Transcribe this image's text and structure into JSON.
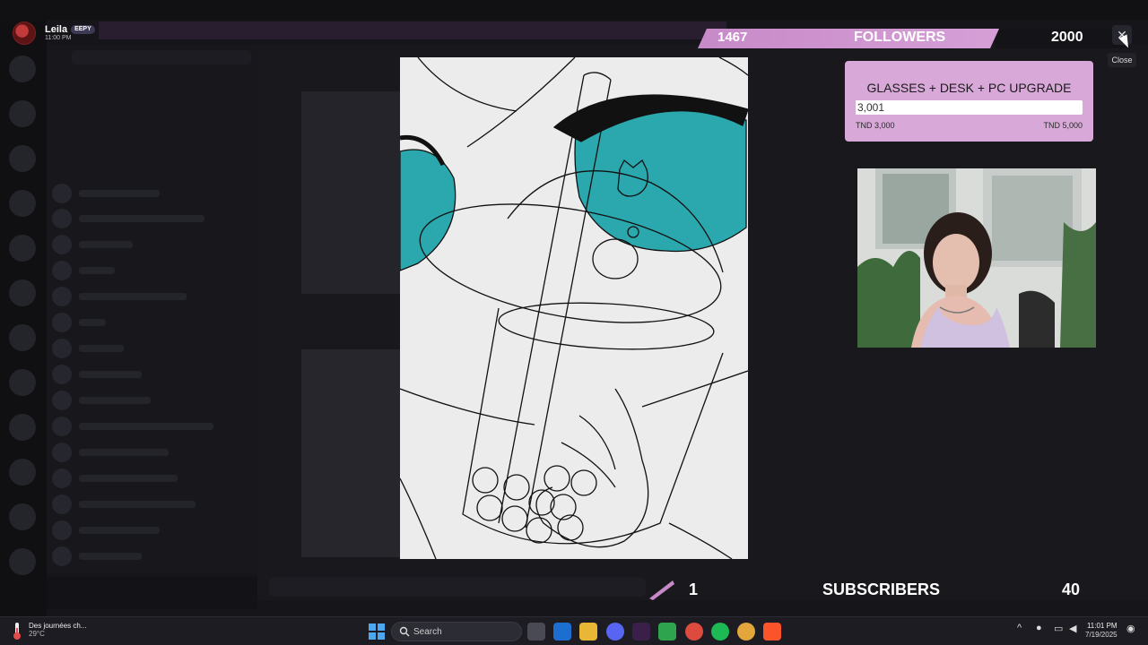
{
  "user": {
    "name": "Leila",
    "badge": "EEPY",
    "time": "11:00 PM"
  },
  "followers": {
    "count": "1467",
    "label": "FOLLOWERS",
    "goal": "2000"
  },
  "close": {
    "icon": "close-icon",
    "tooltip": "Close"
  },
  "goal_card": {
    "title": "GLASSES + DESK + PC UPGRADE",
    "amount": "3,001",
    "min_label": "TND 3,000",
    "max_label": "TND 5,000",
    "progress": 0.0005
  },
  "subscribers": {
    "count": "1",
    "label": "SUBSCRIBERS",
    "goal": "40"
  },
  "taskbar": {
    "weather_title": "Des journées ch...",
    "weather_temp": "29°C",
    "search_label": "Search",
    "time": "11:01 PM",
    "date": "7/19/2025"
  },
  "colors": {
    "followers_bar": "#d69fd6",
    "goal_card": "#d7a8d8",
    "canvas_teal": "#2aa8ad"
  }
}
